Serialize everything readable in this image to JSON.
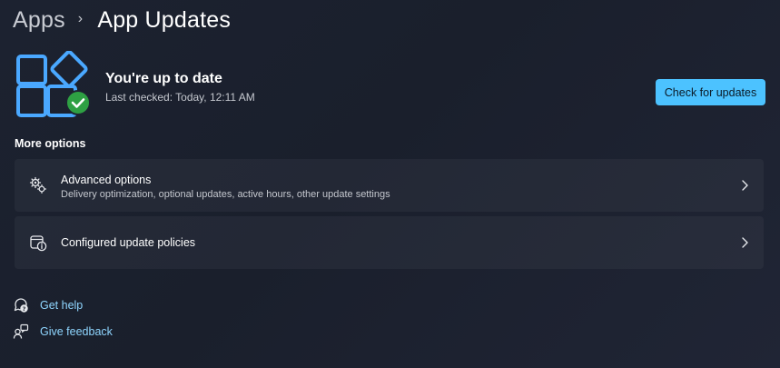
{
  "breadcrumb": {
    "parent": "Apps",
    "separator": "›",
    "current": "App Updates"
  },
  "status": {
    "icon": "windows-update-check-icon",
    "title": "You're up to date",
    "last_checked": "Last checked: Today, 12:11 AM"
  },
  "actions": {
    "check_label": "Check for updates"
  },
  "more_options": {
    "heading": "More options",
    "items": [
      {
        "icon": "gears-icon",
        "title": "Advanced options",
        "subtitle": "Delivery optimization, optional updates, active hours, other update settings"
      },
      {
        "icon": "policy-info-icon",
        "title": "Configured update policies"
      }
    ]
  },
  "help": {
    "get_help": "Get help",
    "give_feedback": "Give feedback"
  },
  "colors": {
    "accent": "#4cc2ff",
    "link": "#8fd6ff",
    "success": "#2ea043"
  }
}
